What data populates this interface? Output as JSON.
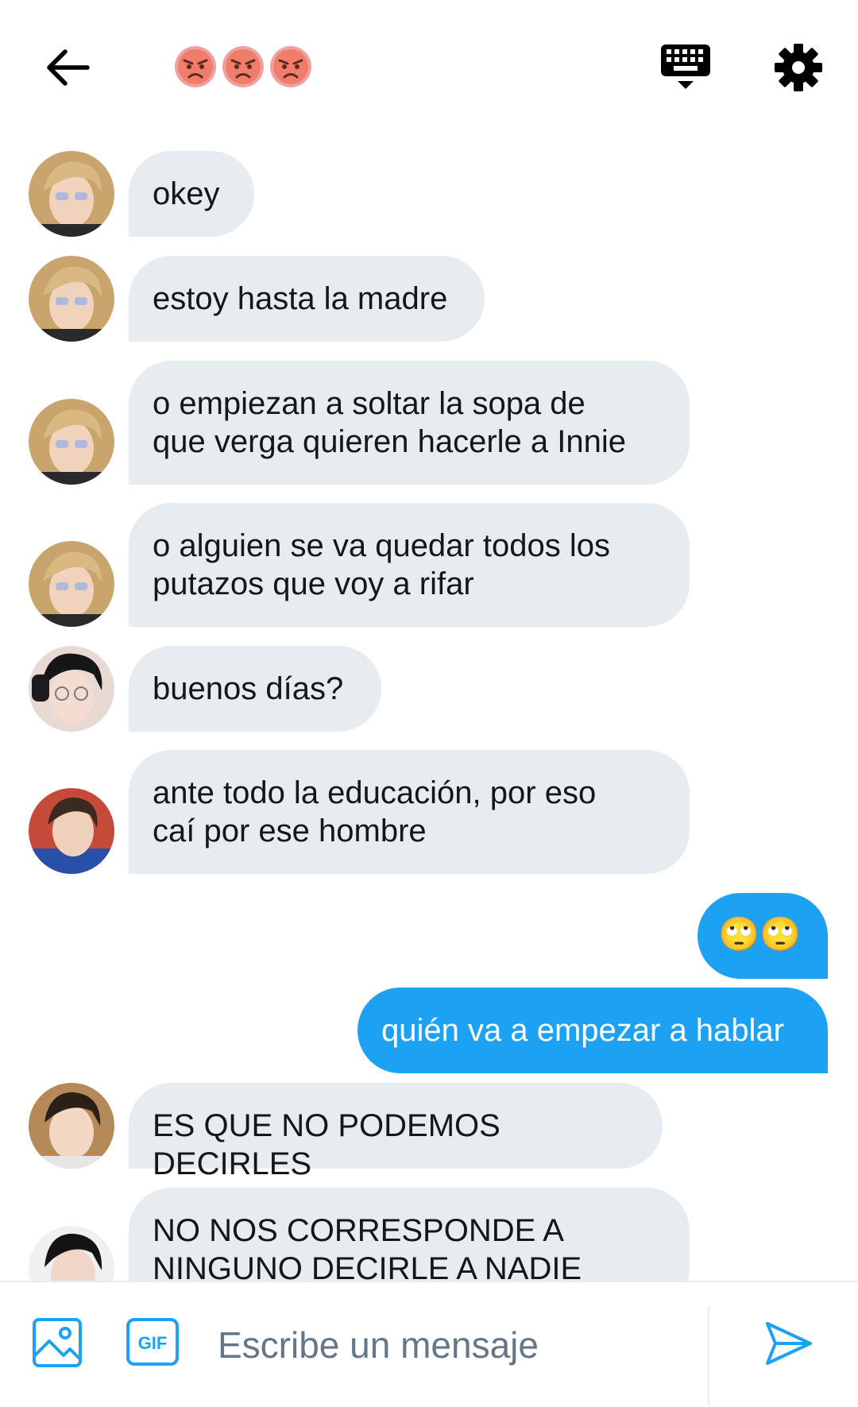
{
  "header": {
    "back_icon": "arrow-left-icon",
    "title_emojis": [
      "angry-face",
      "angry-face",
      "angry-face"
    ],
    "keyboard_icon": "keyboard-icon",
    "settings_icon": "gear-icon",
    "accent_color": "#1da1f2"
  },
  "messages": [
    {
      "direction": "received",
      "text": "okey"
    },
    {
      "direction": "received",
      "text": "estoy hasta la madre"
    },
    {
      "direction": "received",
      "text": "o empiezan a soltar la sopa de\nque verga quieren hacerle a Innie"
    },
    {
      "direction": "received",
      "text": "o alguien se va quedar todos los\nputazos que voy a rifar"
    },
    {
      "direction": "received",
      "text": "buenos días?"
    },
    {
      "direction": "received",
      "text": "ante todo la educación, por eso\ncaí por ese hombre"
    },
    {
      "direction": "sent",
      "text": "🙄🙄"
    },
    {
      "direction": "sent",
      "text": "quién va a empezar a hablar"
    },
    {
      "direction": "received",
      "text": "ES QUE NO PODEMOS DECIRLES"
    },
    {
      "direction": "received",
      "text": "NO NOS CORRESPONDE A\nNINGUNO DECIRLE A NADIE"
    }
  ],
  "composer": {
    "placeholder": "Escribe un mensaje",
    "gif_label": "GIF",
    "image_icon": "image-icon",
    "send_icon": "send-icon"
  }
}
